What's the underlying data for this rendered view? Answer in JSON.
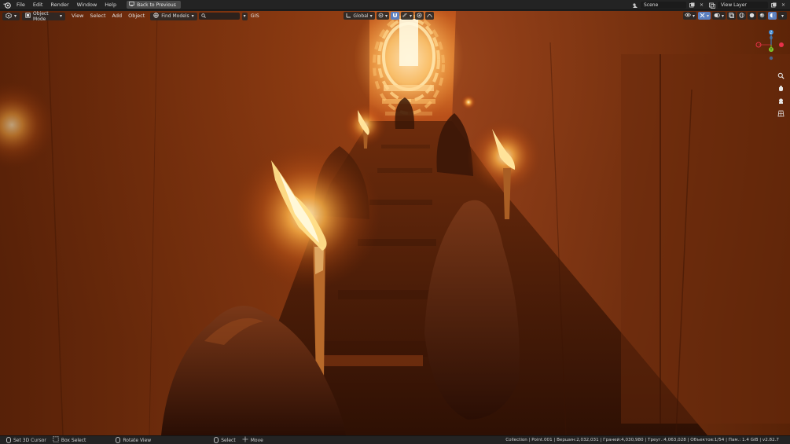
{
  "topbar": {
    "menus": [
      "File",
      "Edit",
      "Render",
      "Window",
      "Help"
    ],
    "back_button": "Back to Previous",
    "scene": "Scene",
    "view_layer": "View Layer"
  },
  "header": {
    "mode": "Object Mode",
    "menus": [
      "View",
      "Select",
      "Add",
      "Object"
    ],
    "find_models": "Find Models",
    "search_placeholder": "",
    "gis": "GIS",
    "orientation": "Global"
  },
  "gizmo": {
    "axis_z": "Z",
    "axis_y": "Y",
    "axis_x": "X",
    "colors": {
      "x": "#e8314a",
      "y": "#7fc92c",
      "z": "#3d8bd8"
    }
  },
  "statusbar": {
    "items": [
      "Set 3D Cursor",
      "Box Select",
      "Rotate View",
      "Select",
      "Move"
    ],
    "info": "Collection | Point.001 | Вершин:2,032,031 | Граней:4,030,980 | Треуг.:4,063,028 | Объектов:1/54 | Пам.: 1.4 GiB | v2.82.7"
  },
  "theme": {
    "accent": "#5b7fbf",
    "bar_bg": "#232323",
    "fire": "#ffb347"
  }
}
